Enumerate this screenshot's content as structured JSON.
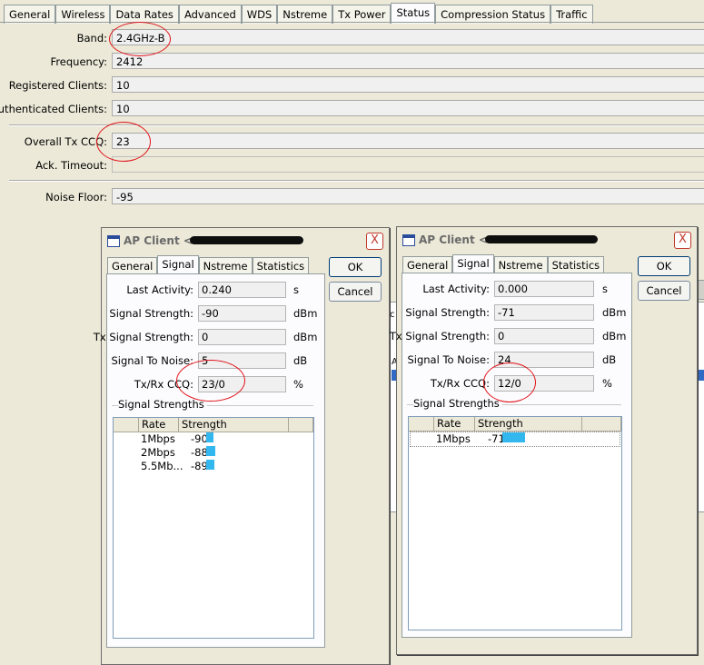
{
  "tabs": [
    "General",
    "Wireless",
    "Data Rates",
    "Advanced",
    "WDS",
    "Nstreme",
    "Tx Power",
    "Status",
    "Compression Status",
    "Traffic"
  ],
  "active_tab": "Status",
  "status": {
    "band_label": "Band:",
    "band_value": "2.4GHz-B",
    "frequency_label": "Frequency:",
    "frequency_value": "2412",
    "registered_label": "Registered Clients:",
    "registered_value": "10",
    "authenticated_label": "Authenticated Clients:",
    "authenticated_value": "10",
    "ccq_label": "Overall Tx CCQ:",
    "ccq_value": "23",
    "ack_label": "Ack. Timeout:",
    "ack_value": "",
    "noise_label": "Noise Floor:",
    "noise_value": "-95"
  },
  "behind_text": {
    "a": "a",
    "b": "c",
    "c": "A"
  },
  "dialog_left": {
    "title": "AP Client <",
    "close": "X",
    "tabs": [
      "General",
      "Signal",
      "Nstreme",
      "Statistics"
    ],
    "active_tab": "Signal",
    "ok": "OK",
    "cancel": "Cancel",
    "fields": [
      {
        "label": "Last Activity:",
        "value": "0.240",
        "unit": "s"
      },
      {
        "label": "Signal Strength:",
        "value": "-90",
        "unit": "dBm"
      },
      {
        "label": "Tx Signal Strength:",
        "value": "0",
        "unit": "dBm"
      },
      {
        "label": "Signal To Noise:",
        "value": "5",
        "unit": "dB"
      },
      {
        "label": "Tx/Rx CCQ:",
        "value": "23/0",
        "unit": "%"
      }
    ],
    "group_title": "Signal Strengths",
    "columns": [
      "Rate",
      "Strength"
    ],
    "rows": [
      {
        "rate": "1Mbps",
        "strength": "-90",
        "bar": 0.07
      },
      {
        "rate": "2Mbps",
        "strength": "-88",
        "bar": 0.09
      },
      {
        "rate": "5.5Mb...",
        "strength": "-89",
        "bar": 0.08
      }
    ]
  },
  "dialog_right": {
    "title": "AP Client <",
    "close": "X",
    "tabs": [
      "General",
      "Signal",
      "Nstreme",
      "Statistics"
    ],
    "active_tab": "Signal",
    "ok": "OK",
    "cancel": "Cancel",
    "fields": [
      {
        "label": "Last Activity:",
        "value": "0.000",
        "unit": "s"
      },
      {
        "label": "Signal Strength:",
        "value": "-71",
        "unit": "dBm"
      },
      {
        "label": "Tx Signal Strength:",
        "value": "0",
        "unit": "dBm"
      },
      {
        "label": "Signal To Noise:",
        "value": "24",
        "unit": "dB"
      },
      {
        "label": "Tx/Rx CCQ:",
        "value": "12/0",
        "unit": "%"
      }
    ],
    "group_title": "Signal Strengths",
    "columns": [
      "Rate",
      "Strength"
    ],
    "rows": [
      {
        "rate": "1Mbps",
        "strength": "-71",
        "bar": 0.22
      }
    ]
  },
  "colors": {
    "highlight": "#e0141a",
    "signal_bar": "#33b7ef",
    "window_bg": "#ece9d8"
  }
}
